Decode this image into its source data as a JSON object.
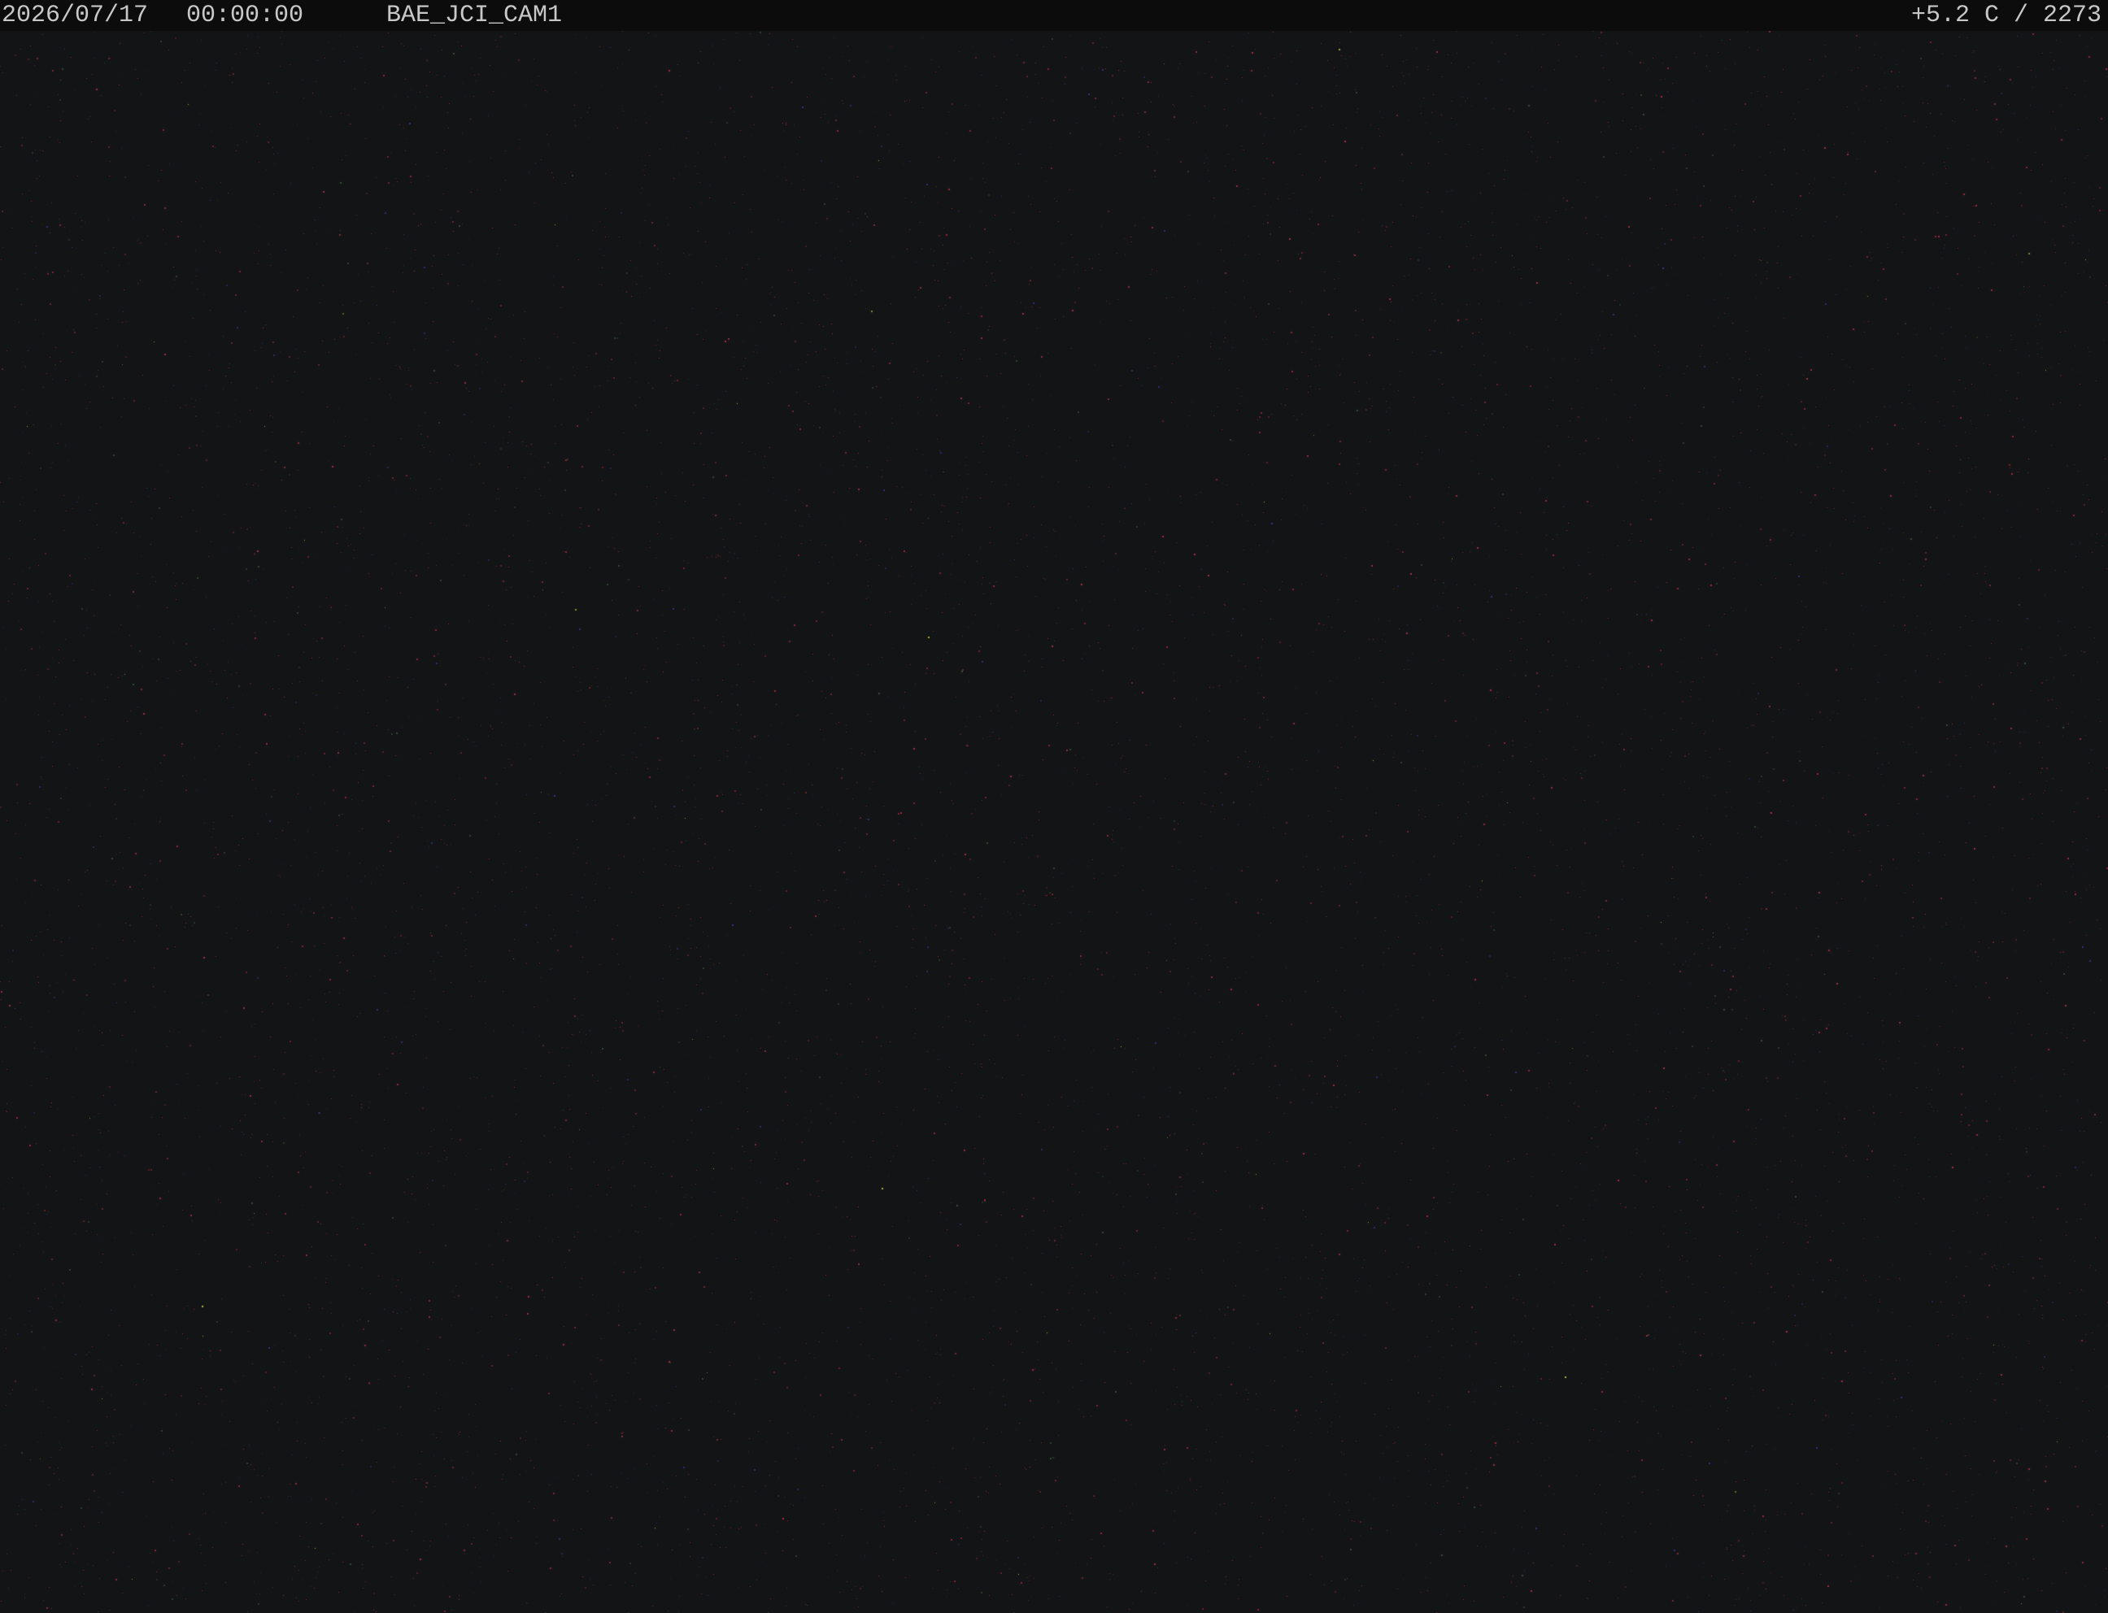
{
  "overlay": {
    "date": "2026/07/17",
    "time": "00:00:00",
    "camera_name": "BAE_JCI_CAM1",
    "temperature_and_frame": "+5.2 C / 2273"
  },
  "scene": {
    "description_type": "night-sky-camera-frame",
    "background_color": "#131415",
    "overlay_text_color": "#c8c8c8",
    "speck_colors": [
      "#c0304a",
      "#8a2a3a",
      "#3a5a3a",
      "#3a3aa0",
      "#d0d040"
    ]
  }
}
